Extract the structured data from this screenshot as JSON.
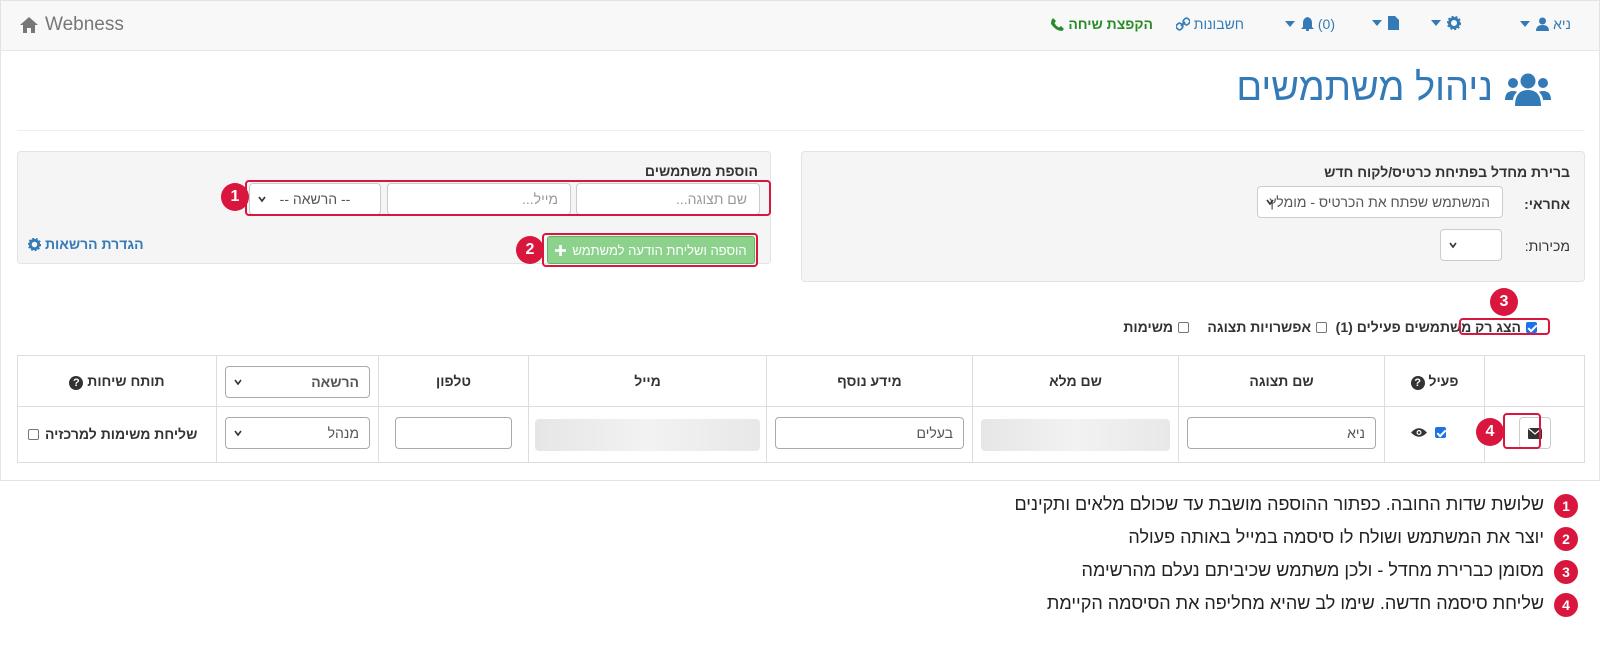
{
  "navbar": {
    "brand": "Webness",
    "user_name": "ניא",
    "notifications_count": "(0)",
    "accounts_label": "חשבונות",
    "call_popup_label": "הקפצת שיחה",
    "accent_color": "#337ab7",
    "call_color": "#2a8a2a"
  },
  "page_title": "ניהול משתמשים",
  "default_responsible": {
    "heading": "ברירת מחדל בפתיחת כרטיס/לקוח חדש",
    "responsible_label": "אחראי:",
    "responsible_value": "המשתמש שפתח את הכרטיס - מומלץ",
    "sales_label": "מכירות:",
    "sales_value": ""
  },
  "add_users": {
    "heading": "הוספת משתמשים",
    "display_name_placeholder": "שם תצוגה...",
    "email_placeholder": "מייל...",
    "permission_placeholder": "-- הרשאה --",
    "add_button_label": "הוספה ושליחת הודעה למשתמש",
    "permissions_link": "הגדרת הרשאות"
  },
  "options": {
    "active_only_label": "הצג רק משתמשים פעילים (1)",
    "active_only_checked": true,
    "display_options_label": "אפשרויות תצוגה",
    "tasks_label": "משימות"
  },
  "table": {
    "headers": [
      "",
      "פעיל",
      "שם תצוגה",
      "שם מלא",
      "מידע נוסף",
      "מייל",
      "טלפון",
      "הרשאה",
      "תותח שיחות"
    ],
    "row": {
      "active": true,
      "display_name": "ניא",
      "full_name": "",
      "extra_info": "בעלים",
      "email": "",
      "phone": "",
      "permission": "מנהל",
      "send_tasks_label": "שליחת משימות למרכזיה"
    }
  },
  "legend": [
    {
      "num": "1",
      "text": "שלושת שדות החובה. כפתור ההוספה מושבת עד שכולם מלאים ותקינים"
    },
    {
      "num": "2",
      "text": "יוצר את המשתמש ושולח לו סיסמה במייל באותה פעולה"
    },
    {
      "num": "3",
      "text": "מסומן כברירת מחדל - ולכן משתמש שכיביתם נעלם מהרשימה"
    },
    {
      "num": "4",
      "text": "שליחת סיסמה חדשה. שימו לב שהיא מחליפה את הסיסמה הקיימת"
    }
  ],
  "badges": [
    "1",
    "2",
    "3",
    "4"
  ],
  "annotation_color": "#d9163d"
}
